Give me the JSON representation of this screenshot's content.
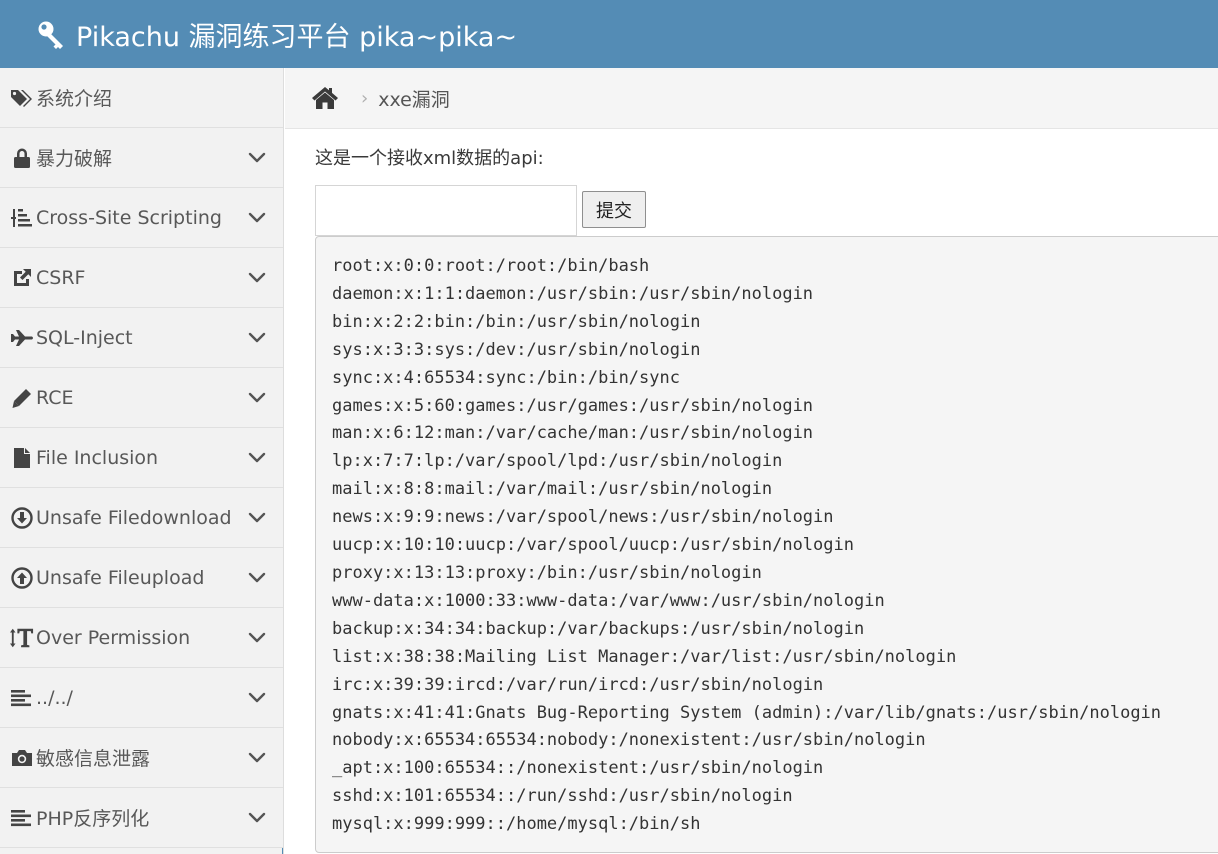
{
  "app": {
    "title": "Pikachu 漏洞练习平台 pika~pika~"
  },
  "sidebar": {
    "items": [
      {
        "label": "系统介绍",
        "icon": "tags-icon",
        "has_children": false
      },
      {
        "label": "暴力破解",
        "icon": "lock-icon",
        "has_children": true
      },
      {
        "label": "Cross-Site Scripting",
        "icon": "list-tree-icon",
        "has_children": true
      },
      {
        "label": "CSRF",
        "icon": "share-icon",
        "has_children": true
      },
      {
        "label": "SQL-Inject",
        "icon": "plane-icon",
        "has_children": true
      },
      {
        "label": "RCE",
        "icon": "pencil-icon",
        "has_children": true
      },
      {
        "label": "File Inclusion",
        "icon": "file-icon",
        "has_children": true
      },
      {
        "label": "Unsafe Filedownload",
        "icon": "download-circle-icon",
        "has_children": true
      },
      {
        "label": "Unsafe Fileupload",
        "icon": "upload-circle-icon",
        "has_children": true
      },
      {
        "label": "Over Permission",
        "icon": "text-height-icon",
        "has_children": true
      },
      {
        "label": "../../",
        "icon": "align-left-icon",
        "has_children": true
      },
      {
        "label": "敏感信息泄露",
        "icon": "camera-icon",
        "has_children": true
      },
      {
        "label": "PHP反序列化",
        "icon": "align-left-icon",
        "has_children": true
      }
    ]
  },
  "breadcrumb": {
    "home_icon": "home-icon",
    "current": "xxe漏洞"
  },
  "main": {
    "api_label": "这是一个接收xml数据的api:",
    "input": {
      "value": "",
      "placeholder": ""
    },
    "submit_label": "提交",
    "output_lines": [
      "root:x:0:0:root:/root:/bin/bash",
      "daemon:x:1:1:daemon:/usr/sbin:/usr/sbin/nologin",
      "bin:x:2:2:bin:/bin:/usr/sbin/nologin",
      "sys:x:3:3:sys:/dev:/usr/sbin/nologin",
      "sync:x:4:65534:sync:/bin:/bin/sync",
      "games:x:5:60:games:/usr/games:/usr/sbin/nologin",
      "man:x:6:12:man:/var/cache/man:/usr/sbin/nologin",
      "lp:x:7:7:lp:/var/spool/lpd:/usr/sbin/nologin",
      "mail:x:8:8:mail:/var/mail:/usr/sbin/nologin",
      "news:x:9:9:news:/var/spool/news:/usr/sbin/nologin",
      "uucp:x:10:10:uucp:/var/spool/uucp:/usr/sbin/nologin",
      "proxy:x:13:13:proxy:/bin:/usr/sbin/nologin",
      "www-data:x:1000:33:www-data:/var/www:/usr/sbin/nologin",
      "backup:x:34:34:backup:/var/backups:/usr/sbin/nologin",
      "list:x:38:38:Mailing List Manager:/var/list:/usr/sbin/nologin",
      "irc:x:39:39:ircd:/var/run/ircd:/usr/sbin/nologin",
      "gnats:x:41:41:Gnats Bug-Reporting System (admin):/var/lib/gnats:/usr/sbin/nologin",
      "nobody:x:65534:65534:nobody:/nonexistent:/usr/sbin/nologin",
      "_apt:x:100:65534::/nonexistent:/usr/sbin/nologin",
      "sshd:x:101:65534::/run/sshd:/usr/sbin/nologin",
      "mysql:x:999:999::/home/mysql:/bin/sh"
    ]
  },
  "colors": {
    "header_bg": "#548cb5",
    "sidebar_bg": "#f2f2f2",
    "breadcrumb_bg": "#f5f5f5",
    "output_bg": "#f5f5f5"
  }
}
